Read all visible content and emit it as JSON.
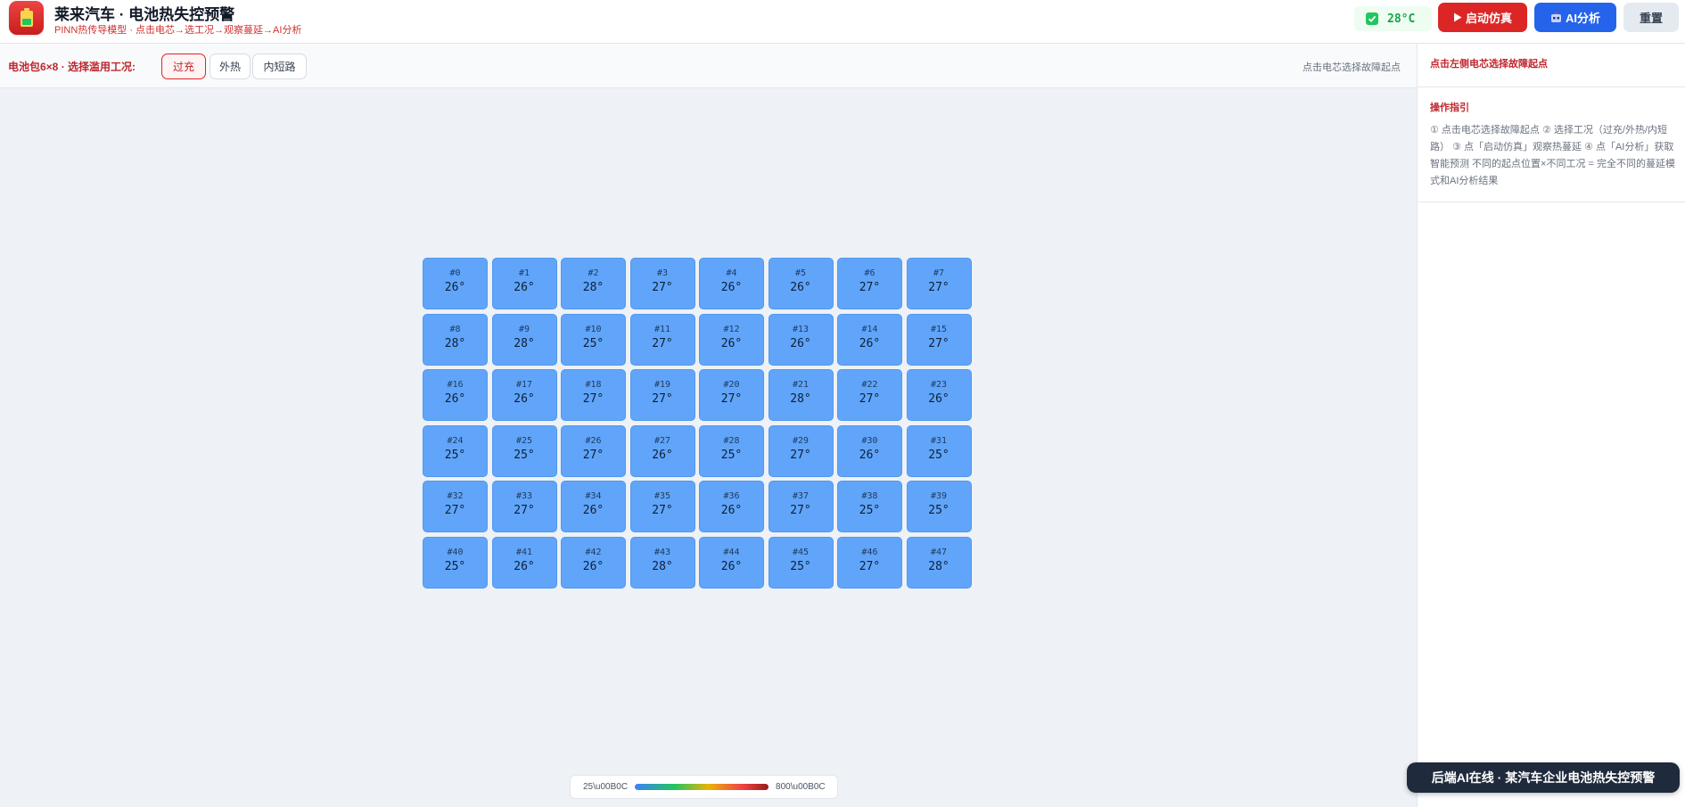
{
  "header": {
    "title": "莱来汽车 · 电池热失控预警",
    "subtitle": "PINN热传导模型 · 点击电芯→选工况→观察蔓延→AI分析",
    "temperature": "28°C",
    "start_label": "启动仿真",
    "ai_label": "AI分析",
    "reset_label": "重置",
    "logo_icon": "battery-icon",
    "colors": {
      "accent_red": "#dc2626",
      "accent_blue": "#2563eb",
      "ok_green": "#16a34a",
      "cell_blue": "#60a5fa"
    }
  },
  "toolbar": {
    "label": "电池包6×8 · 选择滥用工况:",
    "modes": [
      "过充",
      "外热",
      "内短路"
    ],
    "active_mode": 0,
    "hint": "点击电芯选择故障起点"
  },
  "side": {
    "hint": "点击左侧电芯选择故障起点",
    "guide_title": "操作指引",
    "guide_text": "① 点击电芯选择故障起点 ② 选择工况（过充/外热/内短路） ③ 点「启动仿真」观察热蔓延 ④ 点「AI分析」获取智能预测 不同的起点位置×不同工况 = 完全不同的蔓延模式和AI分析结果"
  },
  "grid": {
    "rows": 6,
    "cols": 8,
    "cells": [
      {
        "id": "#0",
        "temp": "26°"
      },
      {
        "id": "#1",
        "temp": "26°"
      },
      {
        "id": "#2",
        "temp": "28°"
      },
      {
        "id": "#3",
        "temp": "27°"
      },
      {
        "id": "#4",
        "temp": "26°"
      },
      {
        "id": "#5",
        "temp": "26°"
      },
      {
        "id": "#6",
        "temp": "27°"
      },
      {
        "id": "#7",
        "temp": "27°"
      },
      {
        "id": "#8",
        "temp": "28°"
      },
      {
        "id": "#9",
        "temp": "28°"
      },
      {
        "id": "#10",
        "temp": "25°"
      },
      {
        "id": "#11",
        "temp": "27°"
      },
      {
        "id": "#12",
        "temp": "26°"
      },
      {
        "id": "#13",
        "temp": "26°"
      },
      {
        "id": "#14",
        "temp": "26°"
      },
      {
        "id": "#15",
        "temp": "27°"
      },
      {
        "id": "#16",
        "temp": "26°"
      },
      {
        "id": "#17",
        "temp": "26°"
      },
      {
        "id": "#18",
        "temp": "27°"
      },
      {
        "id": "#19",
        "temp": "27°"
      },
      {
        "id": "#20",
        "temp": "27°"
      },
      {
        "id": "#21",
        "temp": "28°"
      },
      {
        "id": "#22",
        "temp": "27°"
      },
      {
        "id": "#23",
        "temp": "26°"
      },
      {
        "id": "#24",
        "temp": "25°"
      },
      {
        "id": "#25",
        "temp": "25°"
      },
      {
        "id": "#26",
        "temp": "27°"
      },
      {
        "id": "#27",
        "temp": "26°"
      },
      {
        "id": "#28",
        "temp": "25°"
      },
      {
        "id": "#29",
        "temp": "27°"
      },
      {
        "id": "#30",
        "temp": "26°"
      },
      {
        "id": "#31",
        "temp": "25°"
      },
      {
        "id": "#32",
        "temp": "27°"
      },
      {
        "id": "#33",
        "temp": "27°"
      },
      {
        "id": "#34",
        "temp": "26°"
      },
      {
        "id": "#35",
        "temp": "27°"
      },
      {
        "id": "#36",
        "temp": "26°"
      },
      {
        "id": "#37",
        "temp": "27°"
      },
      {
        "id": "#38",
        "temp": "25°"
      },
      {
        "id": "#39",
        "temp": "25°"
      },
      {
        "id": "#40",
        "temp": "25°"
      },
      {
        "id": "#41",
        "temp": "26°"
      },
      {
        "id": "#42",
        "temp": "26°"
      },
      {
        "id": "#43",
        "temp": "28°"
      },
      {
        "id": "#44",
        "temp": "26°"
      },
      {
        "id": "#45",
        "temp": "25°"
      },
      {
        "id": "#46",
        "temp": "27°"
      },
      {
        "id": "#47",
        "temp": "28°"
      }
    ]
  },
  "legend": {
    "min_label": "25\\u00B0C",
    "max_label": "800\\u00B0C"
  },
  "toast": {
    "text": "后端AI在线 · 某汽车企业电池热失控预警"
  }
}
